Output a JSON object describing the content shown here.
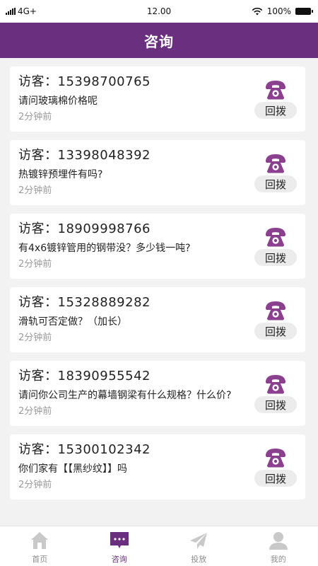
{
  "status_bar": {
    "carrier": "4G+",
    "time": "12.00",
    "battery": "100%"
  },
  "header": {
    "title": "咨询"
  },
  "colors": {
    "brand": "#6a2f7e",
    "phone_icon": "#8b3f8f",
    "tab_inactive": "#c9c9c9"
  },
  "messages": [
    {
      "visitor": "访客：15398700765",
      "question": "请问玻璃棉价格呢",
      "time": "2分钟前",
      "callback": "回拨"
    },
    {
      "visitor": "访客：13398048392",
      "question": "热镀锌预埋件有吗?",
      "time": "2分钟前",
      "callback": "回拨"
    },
    {
      "visitor": "访客：18909998766",
      "question": "有4x6镀锌管用的钢带没？多少钱一吨?",
      "time": "2分钟前",
      "callback": "回拨"
    },
    {
      "visitor": "访客：15328889282",
      "question": "滑轨可否定做？（加长）",
      "time": "2分钟前",
      "callback": "回拨"
    },
    {
      "visitor": "访客：18390955542",
      "question": "请问你公司生产的幕墙钢梁有什么规格？什么价?",
      "time": "2分钟前",
      "callback": "回拨"
    },
    {
      "visitor": "访客：15300102342",
      "question": "你们家有【【黑纱纹】】吗",
      "time": "2分钟前",
      "callback": "回拨"
    }
  ],
  "tabbar": {
    "tabs": [
      {
        "label": "首页",
        "icon": "home-icon"
      },
      {
        "label": "咨询",
        "icon": "chat-icon",
        "active": true
      },
      {
        "label": "投放",
        "icon": "send-icon"
      },
      {
        "label": "我的",
        "icon": "user-icon"
      }
    ]
  }
}
